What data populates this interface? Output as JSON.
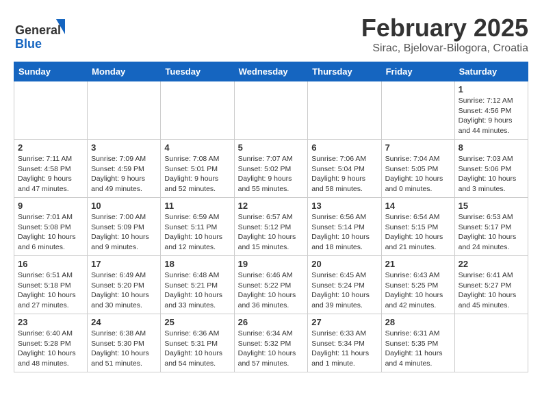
{
  "header": {
    "logo_general": "General",
    "logo_blue": "Blue",
    "month_year": "February 2025",
    "location": "Sirac, Bjelovar-Bilogora, Croatia"
  },
  "days_of_week": [
    "Sunday",
    "Monday",
    "Tuesday",
    "Wednesday",
    "Thursday",
    "Friday",
    "Saturday"
  ],
  "weeks": [
    [
      {
        "day": "",
        "info": ""
      },
      {
        "day": "",
        "info": ""
      },
      {
        "day": "",
        "info": ""
      },
      {
        "day": "",
        "info": ""
      },
      {
        "day": "",
        "info": ""
      },
      {
        "day": "",
        "info": ""
      },
      {
        "day": "1",
        "info": "Sunrise: 7:12 AM\nSunset: 4:56 PM\nDaylight: 9 hours and 44 minutes."
      }
    ],
    [
      {
        "day": "2",
        "info": "Sunrise: 7:11 AM\nSunset: 4:58 PM\nDaylight: 9 hours and 47 minutes."
      },
      {
        "day": "3",
        "info": "Sunrise: 7:09 AM\nSunset: 4:59 PM\nDaylight: 9 hours and 49 minutes."
      },
      {
        "day": "4",
        "info": "Sunrise: 7:08 AM\nSunset: 5:01 PM\nDaylight: 9 hours and 52 minutes."
      },
      {
        "day": "5",
        "info": "Sunrise: 7:07 AM\nSunset: 5:02 PM\nDaylight: 9 hours and 55 minutes."
      },
      {
        "day": "6",
        "info": "Sunrise: 7:06 AM\nSunset: 5:04 PM\nDaylight: 9 hours and 58 minutes."
      },
      {
        "day": "7",
        "info": "Sunrise: 7:04 AM\nSunset: 5:05 PM\nDaylight: 10 hours and 0 minutes."
      },
      {
        "day": "8",
        "info": "Sunrise: 7:03 AM\nSunset: 5:06 PM\nDaylight: 10 hours and 3 minutes."
      }
    ],
    [
      {
        "day": "9",
        "info": "Sunrise: 7:01 AM\nSunset: 5:08 PM\nDaylight: 10 hours and 6 minutes."
      },
      {
        "day": "10",
        "info": "Sunrise: 7:00 AM\nSunset: 5:09 PM\nDaylight: 10 hours and 9 minutes."
      },
      {
        "day": "11",
        "info": "Sunrise: 6:59 AM\nSunset: 5:11 PM\nDaylight: 10 hours and 12 minutes."
      },
      {
        "day": "12",
        "info": "Sunrise: 6:57 AM\nSunset: 5:12 PM\nDaylight: 10 hours and 15 minutes."
      },
      {
        "day": "13",
        "info": "Sunrise: 6:56 AM\nSunset: 5:14 PM\nDaylight: 10 hours and 18 minutes."
      },
      {
        "day": "14",
        "info": "Sunrise: 6:54 AM\nSunset: 5:15 PM\nDaylight: 10 hours and 21 minutes."
      },
      {
        "day": "15",
        "info": "Sunrise: 6:53 AM\nSunset: 5:17 PM\nDaylight: 10 hours and 24 minutes."
      }
    ],
    [
      {
        "day": "16",
        "info": "Sunrise: 6:51 AM\nSunset: 5:18 PM\nDaylight: 10 hours and 27 minutes."
      },
      {
        "day": "17",
        "info": "Sunrise: 6:49 AM\nSunset: 5:20 PM\nDaylight: 10 hours and 30 minutes."
      },
      {
        "day": "18",
        "info": "Sunrise: 6:48 AM\nSunset: 5:21 PM\nDaylight: 10 hours and 33 minutes."
      },
      {
        "day": "19",
        "info": "Sunrise: 6:46 AM\nSunset: 5:22 PM\nDaylight: 10 hours and 36 minutes."
      },
      {
        "day": "20",
        "info": "Sunrise: 6:45 AM\nSunset: 5:24 PM\nDaylight: 10 hours and 39 minutes."
      },
      {
        "day": "21",
        "info": "Sunrise: 6:43 AM\nSunset: 5:25 PM\nDaylight: 10 hours and 42 minutes."
      },
      {
        "day": "22",
        "info": "Sunrise: 6:41 AM\nSunset: 5:27 PM\nDaylight: 10 hours and 45 minutes."
      }
    ],
    [
      {
        "day": "23",
        "info": "Sunrise: 6:40 AM\nSunset: 5:28 PM\nDaylight: 10 hours and 48 minutes."
      },
      {
        "day": "24",
        "info": "Sunrise: 6:38 AM\nSunset: 5:30 PM\nDaylight: 10 hours and 51 minutes."
      },
      {
        "day": "25",
        "info": "Sunrise: 6:36 AM\nSunset: 5:31 PM\nDaylight: 10 hours and 54 minutes."
      },
      {
        "day": "26",
        "info": "Sunrise: 6:34 AM\nSunset: 5:32 PM\nDaylight: 10 hours and 57 minutes."
      },
      {
        "day": "27",
        "info": "Sunrise: 6:33 AM\nSunset: 5:34 PM\nDaylight: 11 hours and 1 minute."
      },
      {
        "day": "28",
        "info": "Sunrise: 6:31 AM\nSunset: 5:35 PM\nDaylight: 11 hours and 4 minutes."
      },
      {
        "day": "",
        "info": ""
      }
    ]
  ]
}
